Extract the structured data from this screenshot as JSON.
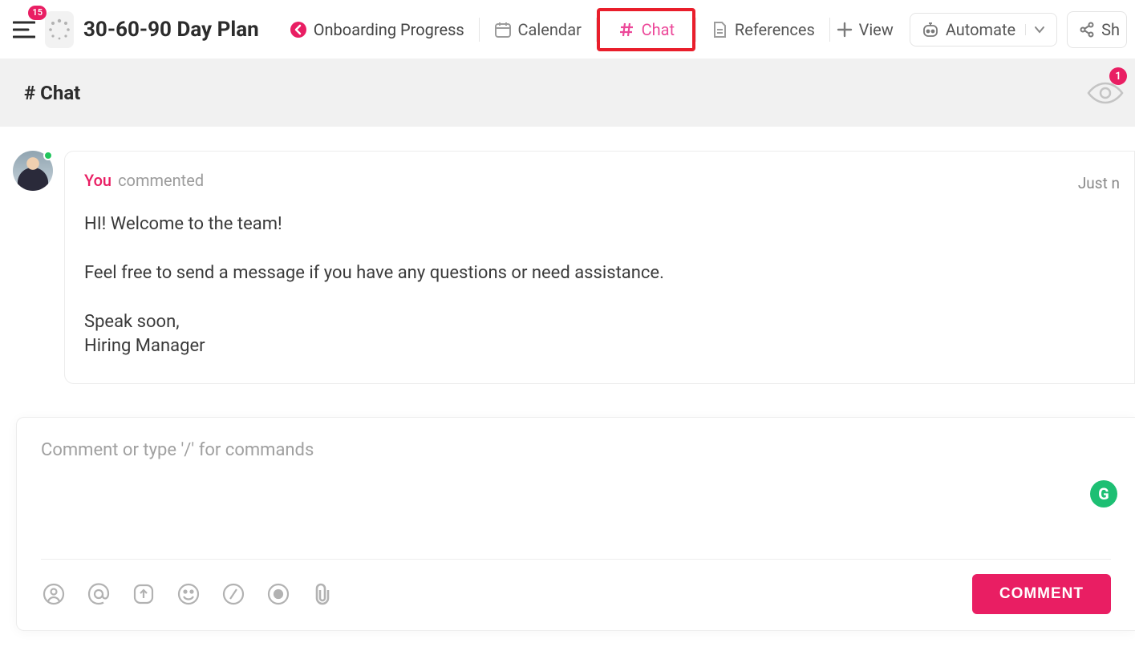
{
  "header": {
    "menu_badge": "15",
    "page_title": "30-60-90 Day Plan",
    "tabs": {
      "onboarding": "Onboarding Progress",
      "calendar": "Calendar",
      "chat": "Chat",
      "references": "References"
    },
    "view_label": "View",
    "automate_label": "Automate",
    "share_label": "Sh"
  },
  "subheader": {
    "title": "# Chat",
    "viewers_badge": "1"
  },
  "message": {
    "author": "You",
    "action": "commented",
    "time": "Just n",
    "line1": "HI! Welcome to the team!",
    "line2": "Feel free to send a message if you have any questions or need assistance.",
    "line3": "Speak soon,",
    "line4": "Hiring Manager"
  },
  "composer": {
    "placeholder": "Comment or type '/' for commands",
    "submit_label": "COMMENT",
    "grammarly_label": "G"
  }
}
